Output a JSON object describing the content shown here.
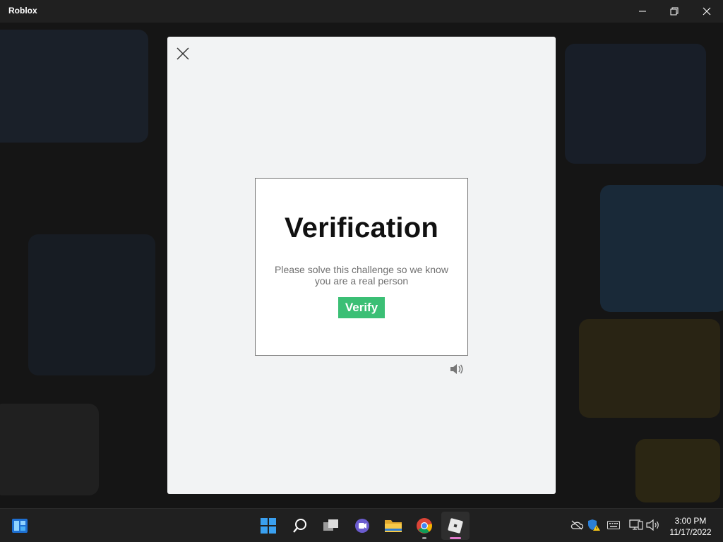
{
  "window": {
    "title": "Roblox",
    "minimize_icon": "minimize-icon",
    "maximize_icon": "restore-icon",
    "close_icon": "close-icon"
  },
  "modal": {
    "close_icon": "close-icon",
    "heading": "Verification",
    "message": "Please solve this challenge so we know you are a real person",
    "verify_label": "Verify",
    "audio_icon": "speaker-icon",
    "accent_color": "#3bbf75"
  },
  "taskbar": {
    "items": [
      "start-icon",
      "search-icon",
      "task-view-icon",
      "teams-chat-icon",
      "file-explorer-icon",
      "chrome-icon",
      "roblox-icon"
    ],
    "tray_icons": [
      "onedrive-icon",
      "security-warning-icon",
      "keyboard-icon",
      "network-icon",
      "volume-icon"
    ],
    "time": "3:00 PM",
    "date": "11/17/2022"
  }
}
